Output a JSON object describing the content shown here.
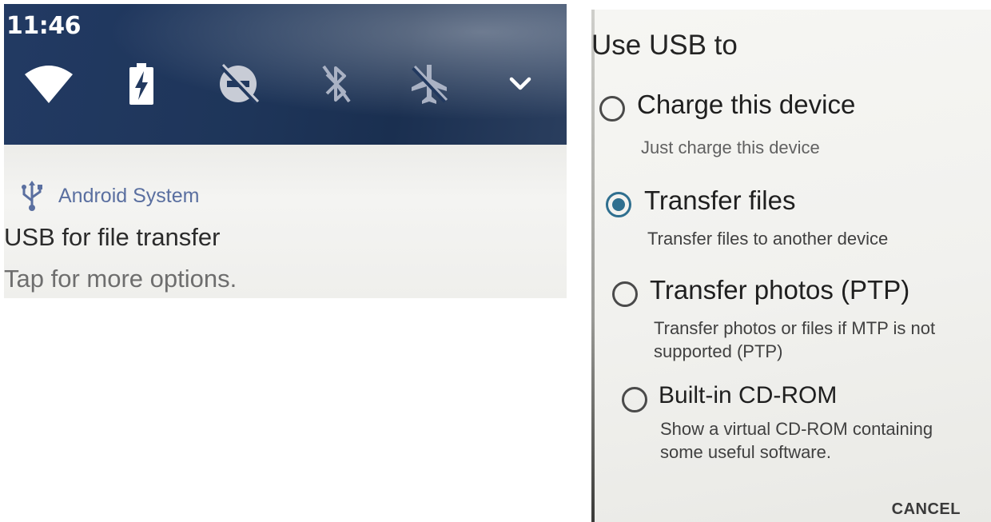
{
  "status_bar": {
    "time": "11:46"
  },
  "quick_settings": {
    "icons": [
      "wifi-icon",
      "battery-charging-icon",
      "do-not-disturb-icon",
      "bluetooth-off-icon",
      "airplane-mode-off-icon",
      "expand-chevron-icon"
    ]
  },
  "notification": {
    "app_name": "Android System",
    "title": "USB for file transfer",
    "text": "Tap for more options."
  },
  "usb_dialog": {
    "title": "Use USB to",
    "options": [
      {
        "label": "Charge this device",
        "description": "Just charge this device",
        "selected": false
      },
      {
        "label": "Transfer files",
        "description": "Transfer files to another device",
        "selected": true
      },
      {
        "label": "Transfer photos (PTP)",
        "description": "Transfer photos or files if MTP is not supported (PTP)",
        "selected": false
      },
      {
        "label": "Built-in CD-ROM",
        "description": "Show a virtual CD-ROM containing some useful software.",
        "selected": false
      }
    ],
    "cancel_label": "CANCEL"
  },
  "colors": {
    "qs_background": "#1e3559",
    "accent": "#2f6f8f",
    "app_name": "#5a6fa0"
  }
}
